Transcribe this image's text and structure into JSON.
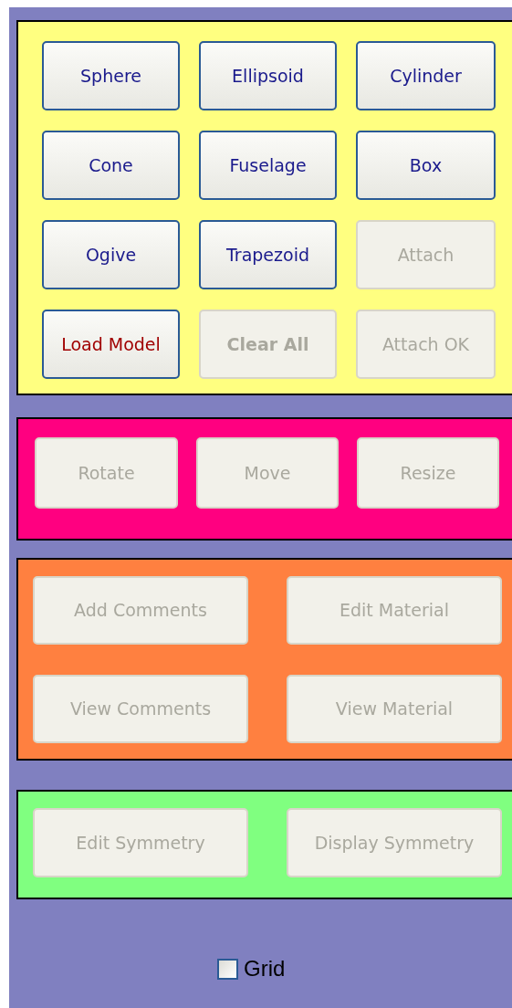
{
  "panels": [
    {
      "color": "#ffff80",
      "buttons": [
        {
          "label": "Sphere",
          "disabled": false,
          "kind": "normal"
        },
        {
          "label": "Ellipsoid",
          "disabled": false,
          "kind": "normal"
        },
        {
          "label": "Cylinder",
          "disabled": false,
          "kind": "normal"
        },
        {
          "label": "Cone",
          "disabled": false,
          "kind": "normal"
        },
        {
          "label": "Fuselage",
          "disabled": false,
          "kind": "normal"
        },
        {
          "label": "Box",
          "disabled": false,
          "kind": "normal"
        },
        {
          "label": "Ogive",
          "disabled": false,
          "kind": "normal"
        },
        {
          "label": "Trapezoid",
          "disabled": false,
          "kind": "normal"
        },
        {
          "label": "Attach",
          "disabled": true,
          "kind": "normal"
        },
        {
          "label": "Load Model",
          "disabled": false,
          "kind": "warning"
        },
        {
          "label": "Clear All",
          "disabled": true,
          "kind": "strong"
        },
        {
          "label": "Attach OK",
          "disabled": true,
          "kind": "normal"
        }
      ]
    },
    {
      "color": "#ff0080",
      "buttons": [
        {
          "label": "Rotate",
          "disabled": true,
          "kind": "normal"
        },
        {
          "label": "Move",
          "disabled": true,
          "kind": "normal"
        },
        {
          "label": "Resize",
          "disabled": true,
          "kind": "normal"
        }
      ]
    },
    {
      "color": "#ff8040",
      "buttons": [
        {
          "label": "Add Comments",
          "disabled": true,
          "kind": "normal"
        },
        {
          "label": "Edit Material",
          "disabled": true,
          "kind": "normal"
        },
        {
          "label": "View Comments",
          "disabled": true,
          "kind": "normal"
        },
        {
          "label": "View Material",
          "disabled": true,
          "kind": "normal"
        }
      ]
    },
    {
      "color": "#80ff80",
      "buttons": [
        {
          "label": "Edit Symmetry",
          "disabled": true,
          "kind": "normal"
        },
        {
          "label": "Display Symmetry",
          "disabled": true,
          "kind": "normal"
        }
      ]
    }
  ],
  "grid": {
    "label": "Grid",
    "checked": false
  }
}
